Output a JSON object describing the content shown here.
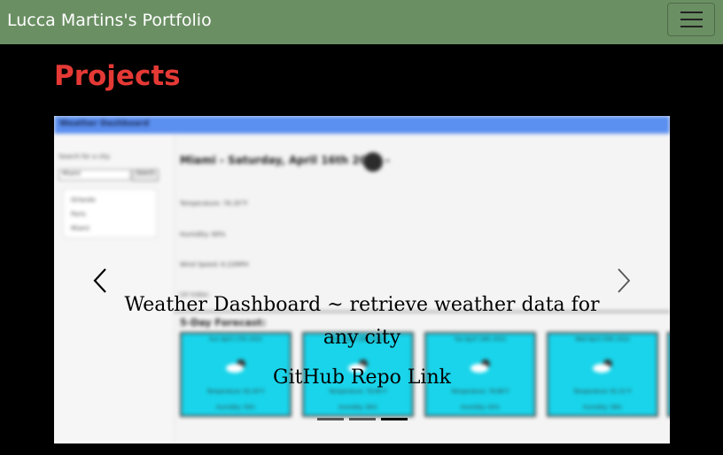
{
  "navbar": {
    "brand": "Lucca Martins's Portfolio",
    "toggler_icon": "hamburger-icon",
    "background": "#6a8f63"
  },
  "page": {
    "heading": "Projects",
    "heading_color": "#e53935"
  },
  "carousel": {
    "caption_title": "Weather Dashboard ~ retrieve weather data for any city",
    "caption_link": "GitHub Repo Link",
    "prev_icon": "chevron-left-icon",
    "next_icon": "chevron-right-icon",
    "indicator_count": 3,
    "active_indicator": 3,
    "slide": {
      "app_title": "Weather Dashboard",
      "search_label": "Search for a city:",
      "search_value": "Miami",
      "search_button": "Search",
      "cities": [
        "Orlando",
        "Paris",
        "Miami"
      ],
      "main_title": "Miami - Saturday, April 16th 2022 -",
      "stats": [
        "Temperature: 76.35°F",
        "Humidity: 69%",
        "Wind Speed: 6.22MPH",
        "UV Index:"
      ],
      "forecast_title": "5-Day Forecast:",
      "forecast": [
        {
          "date": "Sun April 17th 2022",
          "temp": "Temperature: 82.40°F",
          "humidity": "Humidity: 59%"
        },
        {
          "date": "Mon April 18th 2022",
          "temp": "Temperature: 78.96°F",
          "humidity": "Humidity: 66%"
        },
        {
          "date": "Tue April 19th 2022",
          "temp": "Temperature: 78.88°F",
          "humidity": "Humidity: 65%"
        },
        {
          "date": "Wed April 20th 2022",
          "temp": "Temperature: 81.41°F",
          "humidity": "Humidity: 58%"
        }
      ]
    }
  }
}
